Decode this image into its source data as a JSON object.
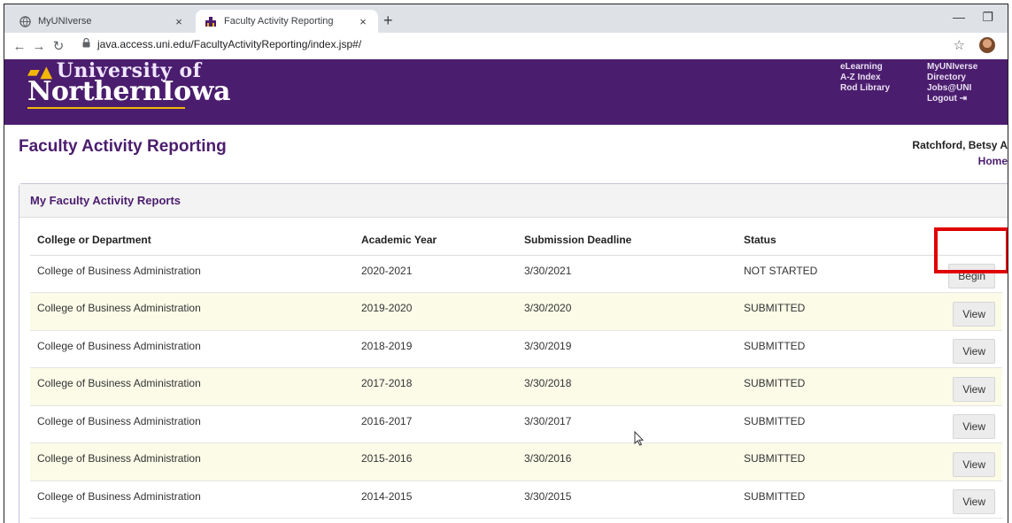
{
  "browser": {
    "tabs": [
      {
        "title": "MyUNIverse",
        "active": false
      },
      {
        "title": "Faculty Activity Reporting",
        "active": true
      }
    ],
    "close_glyph": "×",
    "new_tab_glyph": "+",
    "url": "java.access.uni.edu/FacultyActivityReporting/index.jsp#/"
  },
  "header": {
    "logo_line1": "University of",
    "logo_line2": "NorthernIowa",
    "links_col1": [
      "eLearning",
      "A-Z Index",
      "Rod Library"
    ],
    "links_col2": [
      "MyUNIverse",
      "Directory",
      "Jobs@UNI",
      "Logout"
    ],
    "brand_color": "#4b1d6e",
    "accent_color": "#f2b705"
  },
  "page": {
    "title": "Faculty Activity Reporting",
    "user": "Ratchford, Betsy A",
    "home": "Home"
  },
  "panel": {
    "title": "My Faculty Activity Reports",
    "columns": [
      "College or Department",
      "Academic Year",
      "Submission Deadline",
      "Status"
    ],
    "rows": [
      {
        "dept": "College of Business Administration",
        "year": "2020-2021",
        "deadline": "3/30/2021",
        "status": "NOT STARTED",
        "action": "Begin"
      },
      {
        "dept": "College of Business Administration",
        "year": "2019-2020",
        "deadline": "3/30/2020",
        "status": "SUBMITTED",
        "action": "View"
      },
      {
        "dept": "College of Business Administration",
        "year": "2018-2019",
        "deadline": "3/30/2019",
        "status": "SUBMITTED",
        "action": "View"
      },
      {
        "dept": "College of Business Administration",
        "year": "2017-2018",
        "deadline": "3/30/2018",
        "status": "SUBMITTED",
        "action": "View"
      },
      {
        "dept": "College of Business Administration",
        "year": "2016-2017",
        "deadline": "3/30/2017",
        "status": "SUBMITTED",
        "action": "View"
      },
      {
        "dept": "College of Business Administration",
        "year": "2015-2016",
        "deadline": "3/30/2016",
        "status": "SUBMITTED",
        "action": "View"
      },
      {
        "dept": "College of Business Administration",
        "year": "2014-2015",
        "deadline": "3/30/2015",
        "status": "SUBMITTED",
        "action": "View"
      }
    ]
  }
}
